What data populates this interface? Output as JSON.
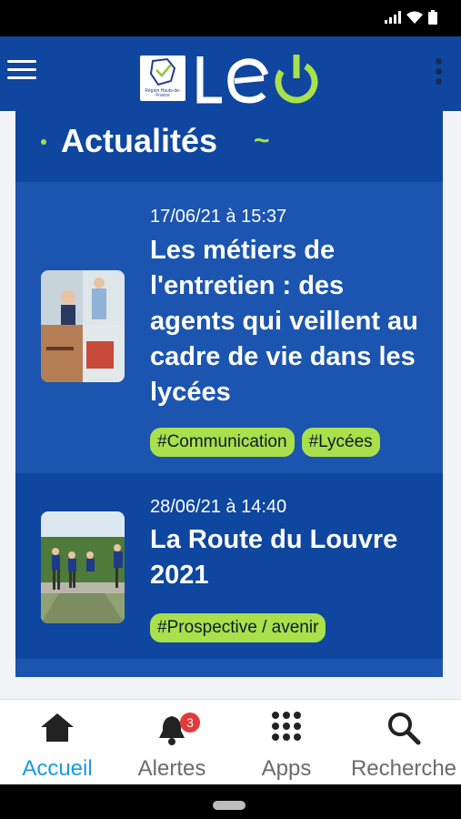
{
  "section": {
    "title": "Actualités",
    "accent": "~"
  },
  "news": [
    {
      "date": "17/06/21 à 15:37",
      "title": "Les métiers de l'entretien : des agents qui veillent au cadre de vie dans les lycées",
      "tags": [
        "#Communication",
        "#Lycées"
      ]
    },
    {
      "date": "28/06/21 à 14:40",
      "title": "La Route du Louvre 2021",
      "tags": [
        "#Prospective / avenir"
      ]
    }
  ],
  "logo": {
    "brand": "LEO",
    "region_text": "Région Hauts-de-France"
  },
  "nav": {
    "home_label": "Accueil",
    "alerts_label": "Alertes",
    "alerts_count": "3",
    "apps_label": "Apps",
    "search_label": "Recherche"
  },
  "colors": {
    "primary": "#0e46a0",
    "accent": "#a9e04b",
    "active": "#1a9be0"
  }
}
